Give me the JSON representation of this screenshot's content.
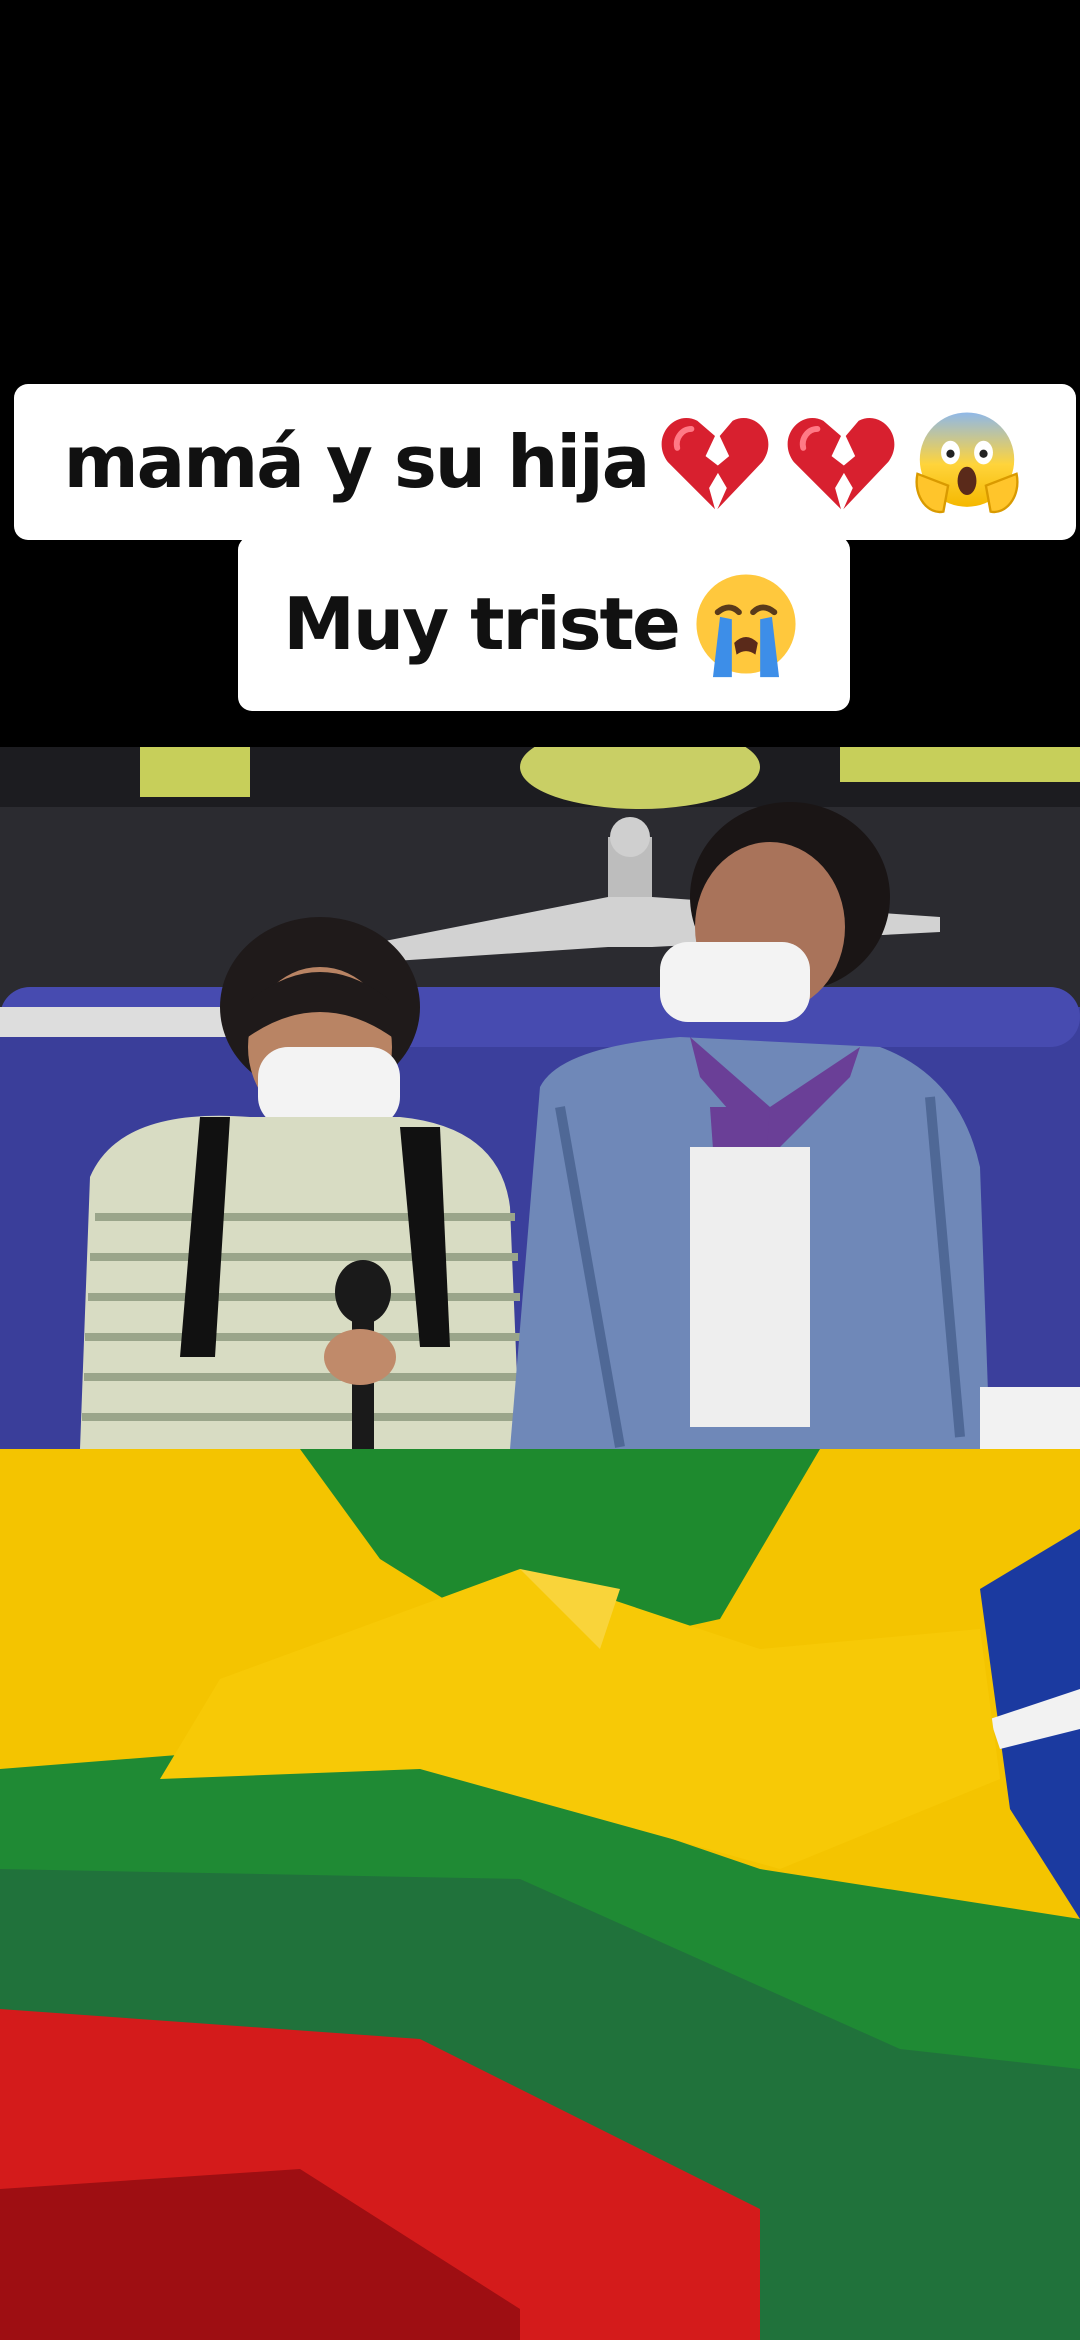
{
  "caption": {
    "line1": "mamá y su hija",
    "line2": "Muy triste",
    "line1_emojis": [
      "broken-heart",
      "broken-heart",
      "face-screaming-in-fear"
    ],
    "line2_emojis": [
      "loudly-crying-face"
    ]
  },
  "colors": {
    "background": "#000000",
    "caption_bg": "#ffffff",
    "caption_text": "#111111",
    "flag_yellow": "#f4c400",
    "flag_green": "#1e8a2e",
    "flag_red": "#d41b1b",
    "flag_blue": "#1b3aa0",
    "sofa_blue": "#3b3f9c"
  }
}
